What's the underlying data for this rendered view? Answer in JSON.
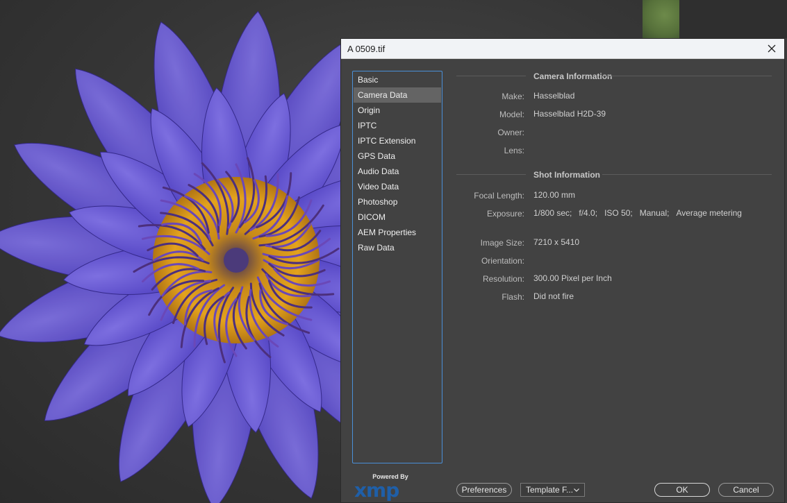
{
  "window": {
    "title": "A 0509.tif"
  },
  "categories": [
    {
      "label": "Basic",
      "selected": false
    },
    {
      "label": "Camera Data",
      "selected": true
    },
    {
      "label": "Origin",
      "selected": false
    },
    {
      "label": "IPTC",
      "selected": false
    },
    {
      "label": "IPTC Extension",
      "selected": false
    },
    {
      "label": "GPS Data",
      "selected": false
    },
    {
      "label": "Audio Data",
      "selected": false
    },
    {
      "label": "Video Data",
      "selected": false
    },
    {
      "label": "Photoshop",
      "selected": false
    },
    {
      "label": "DICOM",
      "selected": false
    },
    {
      "label": "AEM Properties",
      "selected": false
    },
    {
      "label": "Raw Data",
      "selected": false
    }
  ],
  "camera_info": {
    "heading": "Camera Information",
    "make_label": "Make:",
    "make": "Hasselblad",
    "model_label": "Model:",
    "model": "Hasselblad H2D-39",
    "owner_label": "Owner:",
    "owner": "",
    "lens_label": "Lens:",
    "lens": ""
  },
  "shot_info": {
    "heading": "Shot Information",
    "focal_label": "Focal Length:",
    "focal": "120.00 mm",
    "exposure_label": "Exposure:",
    "exposure": [
      "1/800 sec;",
      "f/4.0;",
      "ISO 50;",
      "Manual;",
      "Average metering"
    ],
    "image_size_label": "Image Size:",
    "image_size": "7210 x 5410",
    "orientation_label": "Orientation:",
    "orientation": "",
    "resolution_label": "Resolution:",
    "resolution": "300.00 Pixel per Inch",
    "flash_label": "Flash:",
    "flash": "Did not fire"
  },
  "footer": {
    "powered_by": "Powered By",
    "logo_text": "xmp",
    "preferences_label": "Preferences",
    "template_value": "Template F...",
    "ok_label": "OK",
    "cancel_label": "Cancel"
  },
  "colors": {
    "dialog_bg": "#424242",
    "selection": "#646464",
    "focus_border": "#4a90d9",
    "xmp_blue": "#1f5fa8"
  }
}
